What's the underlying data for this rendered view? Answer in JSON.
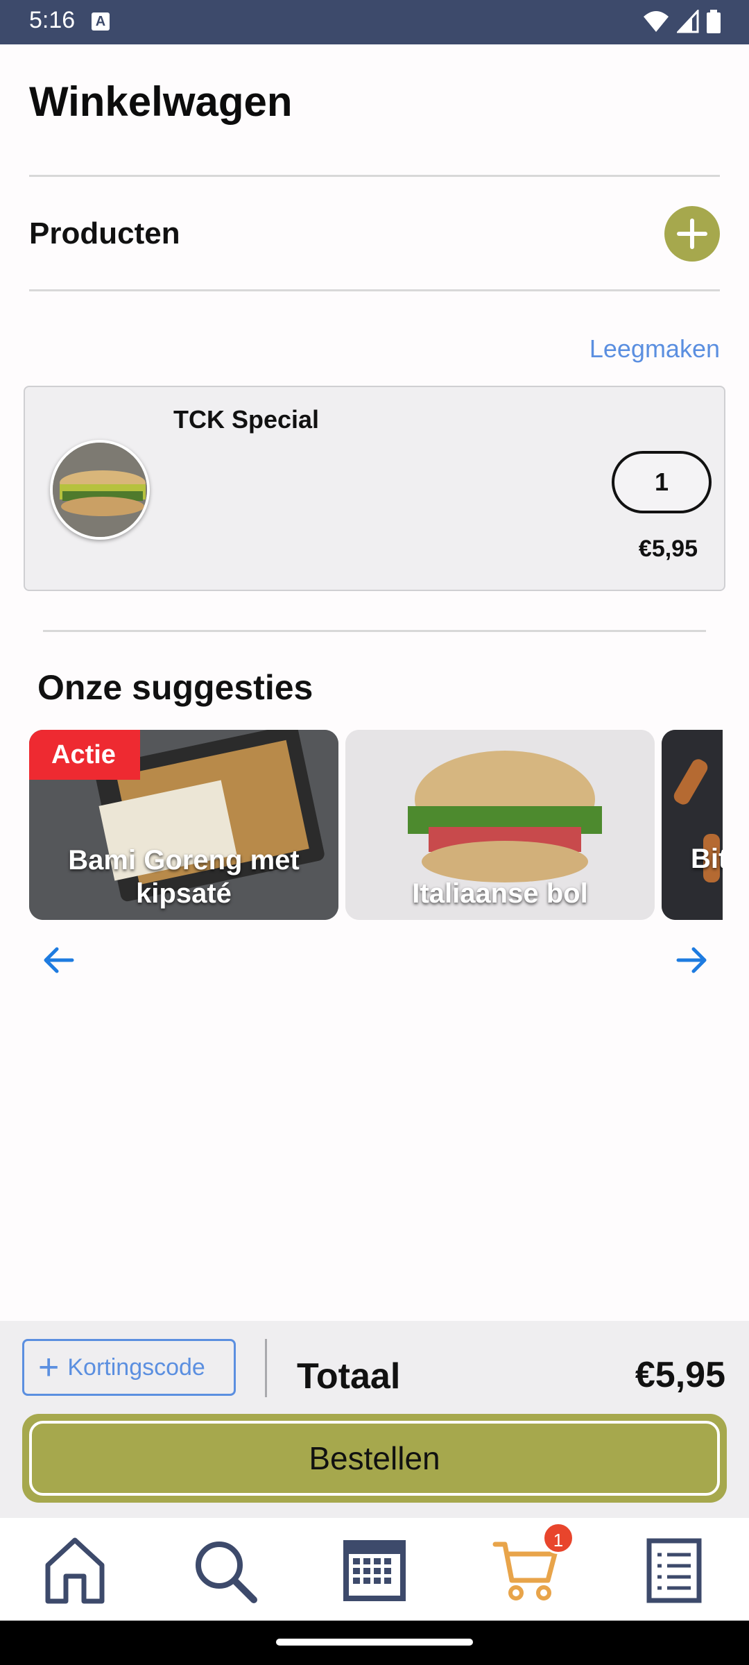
{
  "status_bar": {
    "time": "5:16",
    "a_label": "A"
  },
  "header": {
    "title": "Winkelwagen"
  },
  "products": {
    "title": "Producten",
    "clear_label": "Leegmaken"
  },
  "cart_item": {
    "name": "TCK Special",
    "quantity": "1",
    "price": "€5,95"
  },
  "suggestions": {
    "title": "Onze suggesties",
    "items": [
      {
        "name": "Bami Goreng met kipsaté",
        "badge": "Actie"
      },
      {
        "name": "Italiaanse bol",
        "badge": ""
      },
      {
        "name": "Bit",
        "badge": ""
      }
    ]
  },
  "checkout": {
    "coupon_label": "Kortingscode",
    "total_label": "Totaal",
    "total_value": "€5,95",
    "order_label": "Bestellen"
  },
  "nav": {
    "items": [
      "home-icon",
      "search-icon",
      "calendar-icon",
      "cart-icon",
      "orders-icon"
    ],
    "cart_count": "1",
    "active": "cart-icon"
  },
  "colors": {
    "accent": "#a6a84d",
    "link": "#5b8fe0",
    "status_bar": "#3d4a6b",
    "badge": "#ee2a31",
    "cart_active": "#e8a44a"
  }
}
